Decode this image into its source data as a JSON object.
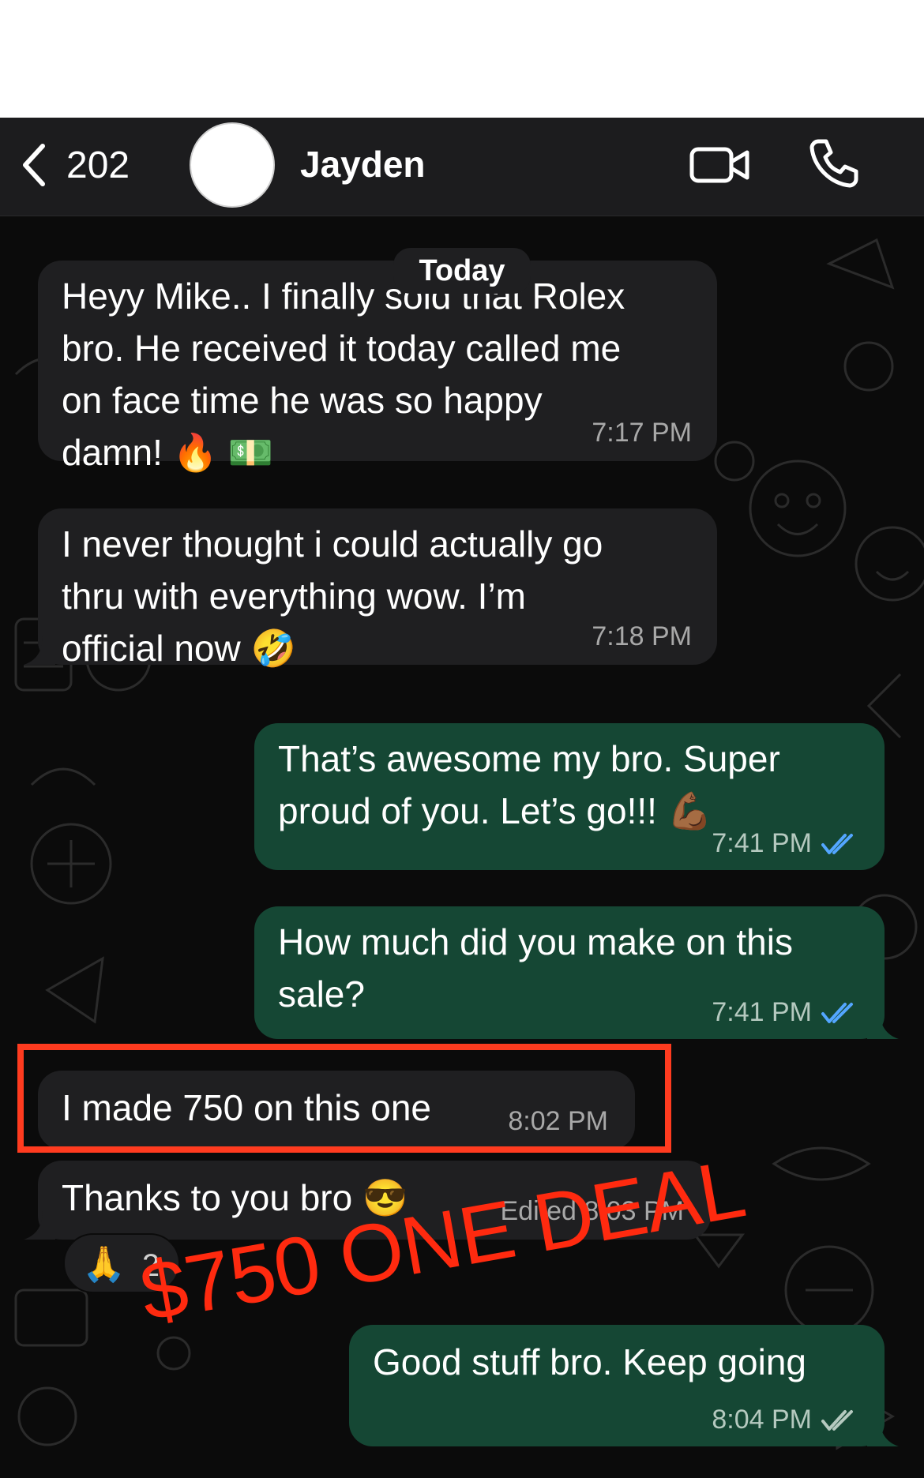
{
  "header": {
    "back_count": "202",
    "contact_name": "Jayden"
  },
  "chat": {
    "date_separator": "Today",
    "messages": [
      {
        "direction": "incoming",
        "text": "Heyy Mike.. I finally sold that Rolex\nbro. He received it today called me\non face time he was so happy\ndamn! 🔥 💵",
        "time": "7:17 PM"
      },
      {
        "direction": "incoming",
        "text": "I never thought i could actually go\nthru with everything wow. I’m\nofficial now 🤣",
        "time": "7:18 PM"
      },
      {
        "direction": "outgoing",
        "text": "That’s awesome my bro. Super\nproud of you. Let’s go!!! 💪🏾",
        "time": "7:41 PM",
        "status": "read"
      },
      {
        "direction": "outgoing",
        "text": "How much did you make on this\nsale?",
        "time": "7:41 PM",
        "status": "read"
      },
      {
        "direction": "incoming",
        "text": "I made 750 on this one",
        "time": "8:02 PM",
        "highlighted": true
      },
      {
        "direction": "incoming",
        "text": "Thanks to you bro 😎",
        "time": "Edited 8:03 PM",
        "reaction": {
          "emoji": "🙏",
          "count": "2"
        }
      },
      {
        "direction": "outgoing",
        "text": "Good stuff bro. Keep going",
        "time": "8:04 PM",
        "status": "delivered"
      }
    ]
  },
  "overlay_text": "$750 ONE DEAL",
  "colors": {
    "incoming_bubble": "#1f1f21",
    "outgoing_bubble": "#154734",
    "read_ticks": "#53a6ff",
    "highlight": "#ff3b1f"
  }
}
